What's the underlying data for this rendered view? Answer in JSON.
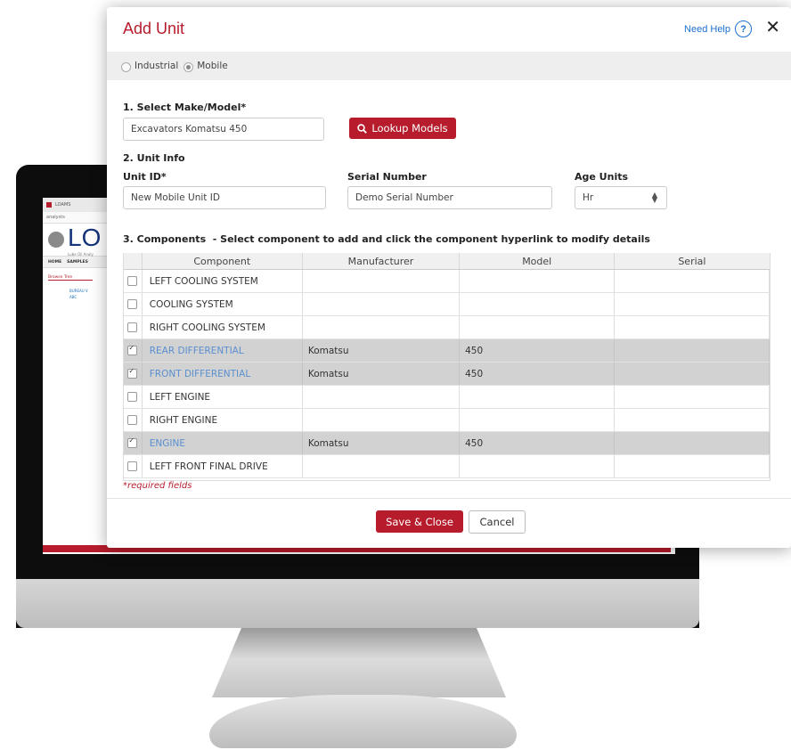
{
  "modal": {
    "title": "Add Unit",
    "help_label": "Need Help",
    "help_icon_glyph": "?",
    "close_glyph": "✕",
    "unit_type": {
      "options": [
        "Industrial",
        "Mobile"
      ],
      "selected": "Mobile"
    },
    "section1": {
      "label": "1. Select Make/Model*",
      "value": "Excavators Komatsu 450",
      "lookup_button": "Lookup Models",
      "lookup_icon": "search-icon"
    },
    "section2": {
      "label": "2. Unit Info",
      "unit_id_label": "Unit ID*",
      "unit_id_value": "New Mobile Unit ID",
      "serial_label": "Serial Number",
      "serial_value": "Demo Serial Number",
      "age_units_label": "Age Units",
      "age_units_value": "Hr"
    },
    "section3": {
      "label": "3. Components  - Select component to add and click the component hyperlink to modify details"
    },
    "table": {
      "columns": [
        "Component",
        "Manufacturer",
        "Model",
        "Serial"
      ],
      "rows": [
        {
          "component": "LEFT COOLING SYSTEM",
          "manufacturer": "",
          "model": "",
          "serial": "",
          "checked": false
        },
        {
          "component": "COOLING SYSTEM",
          "manufacturer": "",
          "model": "",
          "serial": "",
          "checked": false
        },
        {
          "component": "RIGHT COOLING SYSTEM",
          "manufacturer": "",
          "model": "",
          "serial": "",
          "checked": false
        },
        {
          "component": "REAR DIFFERENTIAL",
          "manufacturer": "Komatsu",
          "model": "450",
          "serial": "",
          "checked": true
        },
        {
          "component": "FRONT DIFFERENTIAL",
          "manufacturer": "Komatsu",
          "model": "450",
          "serial": "",
          "checked": true
        },
        {
          "component": "LEFT ENGINE",
          "manufacturer": "",
          "model": "",
          "serial": "",
          "checked": false
        },
        {
          "component": "RIGHT ENGINE",
          "manufacturer": "",
          "model": "",
          "serial": "",
          "checked": false
        },
        {
          "component": "ENGINE",
          "manufacturer": "Komatsu",
          "model": "450",
          "serial": "",
          "checked": true
        },
        {
          "component": "LEFT FRONT FINAL DRIVE",
          "manufacturer": "",
          "model": "",
          "serial": "",
          "checked": false
        }
      ]
    },
    "required_note": "*required fields",
    "save_button": "Save & Close",
    "cancel_button": "Cancel"
  },
  "background_app": {
    "tab_label": "LOAMS",
    "url_text": "analysts",
    "logo_text": "LO",
    "logo_sub": "Lube Oil Analy",
    "nav_items": [
      "HOME",
      "SAMPLES"
    ],
    "browse_tab": "Browse Tree",
    "tree_items": [
      "BUREAU V",
      "ABC"
    ]
  },
  "colors": {
    "brand_red": "#b71c2c",
    "link_blue": "#1d6fd0",
    "selected_row": "#d2d2d2"
  }
}
